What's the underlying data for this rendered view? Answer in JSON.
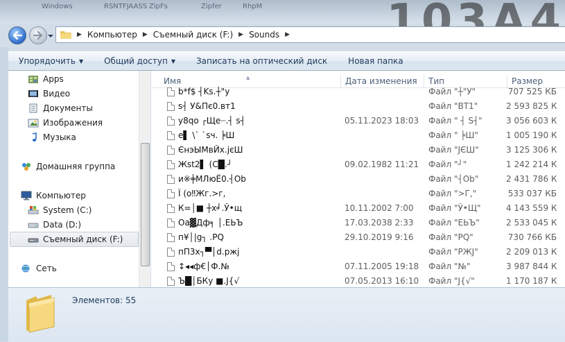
{
  "background": {
    "bg_labels": [
      "Windows",
      "RSNTFJAASS",
      "ZipFs",
      "Zipfer",
      "RhpM"
    ],
    "watermark": "103A4"
  },
  "nav": {
    "breadcrumbs": [
      {
        "label": "Компьютер"
      },
      {
        "label": "Съемный диск (F:)"
      },
      {
        "label": "Sounds"
      }
    ]
  },
  "toolbar": {
    "organize": "Упорядочить",
    "share": "Общий доступ",
    "burn": "Записать на оптический диск",
    "new_folder": "Новая папка"
  },
  "sidebar": {
    "items": [
      {
        "label": "Apps",
        "icon": "apps-icon"
      },
      {
        "label": "Видео",
        "icon": "video-icon"
      },
      {
        "label": "Документы",
        "icon": "documents-icon"
      },
      {
        "label": "Изображения",
        "icon": "pictures-icon"
      },
      {
        "label": "Музыка",
        "icon": "music-icon"
      },
      {
        "label": "Домашняя группа",
        "icon": "homegroup-icon"
      },
      {
        "label": "Компьютер",
        "icon": "computer-icon"
      },
      {
        "label": "System (C:)",
        "icon": "drive-icon"
      },
      {
        "label": "Data (D:)",
        "icon": "drive-icon"
      },
      {
        "label": "Съемный диск (F:)",
        "icon": "removable-drive-icon",
        "selected": true
      },
      {
        "label": "Сеть",
        "icon": "network-icon"
      }
    ]
  },
  "columns": {
    "name": "Имя",
    "date": "Дата изменения",
    "type": "Тип",
    "size": "Размер"
  },
  "files": [
    {
      "name": "b*f$ ┤Ks.┼\"y",
      "date": "",
      "type": "Файл \"┼\"У\"",
      "size": "707 525 КБ"
    },
    {
      "name": "s┤ У&Пє0.вт1",
      "date": "",
      "type": "Файл \"ВТ1\"",
      "size": "2 593 825 КБ"
    },
    {
      "name": "y8qo ┌Щe┈.┤ s┤",
      "date": "05.11.2023 18:03",
      "type": "Файл \" ┤ S┤\"",
      "size": "3 056 603 КБ"
    },
    {
      "name": "e▌ \\` `sч. ╞Ш",
      "date": "",
      "type": "Файл \" ╞Ш\"",
      "size": "1 005 190 КБ"
    },
    {
      "name": "ЄнэЫМвЙх.јєШ",
      "date": "",
      "type": "Файл \"ЈЄШ\"",
      "size": "3 125 306 КБ"
    },
    {
      "name": "Жst2▌ (C█.┘",
      "date": "09.02.1982 11:21",
      "type": "Файл \"┘\"",
      "size": "1 242 214 КБ"
    },
    {
      "name": "и※╪МЛюЁ0.┤Оb",
      "date": "",
      "type": "Файл \"┤Оb\"",
      "size": "2 431 786 КБ"
    },
    {
      "name": "Ї (o‼Жг.>г,",
      "date": "",
      "type": "Файл \">Г,\"",
      "size": "533 037 КБ"
    },
    {
      "name": "К=│■ ┼x╛.Ў•щ",
      "date": "10.11.2002 7:00",
      "type": "Файл \"Ў•Щ\"",
      "size": "4 143 559 КБ"
    },
    {
      "name": "Oa▓Дф╕ │.ЕЬЪ",
      "date": "17.03.2038 2:33",
      "type": "Файл \"ЕЬЪ\"",
      "size": "2 533 045 КБ"
    },
    {
      "name": "п¥│|g┐ .PQ",
      "date": "29.10.2019 9:16",
      "type": "Файл \"PQ\"",
      "size": "730 766 КБ"
    },
    {
      "name": "пП3х┐▀│d.ржј",
      "date": "",
      "type": "Файл \"РЖЈ\"",
      "size": "2 209 013 КБ"
    },
    {
      "name": "↕◂◂ф€│Ф.№",
      "date": "07.11.2005 19:18",
      "type": "Файл \"№\"",
      "size": "3 987 844 КБ"
    },
    {
      "name": "Ъ█│БКу ■.J{√",
      "date": "07.05.2013 16:10",
      "type": "Файл \"J{√\"",
      "size": "1 170 187 КБ"
    }
  ],
  "details": {
    "count_text": "Элементов: 55"
  }
}
